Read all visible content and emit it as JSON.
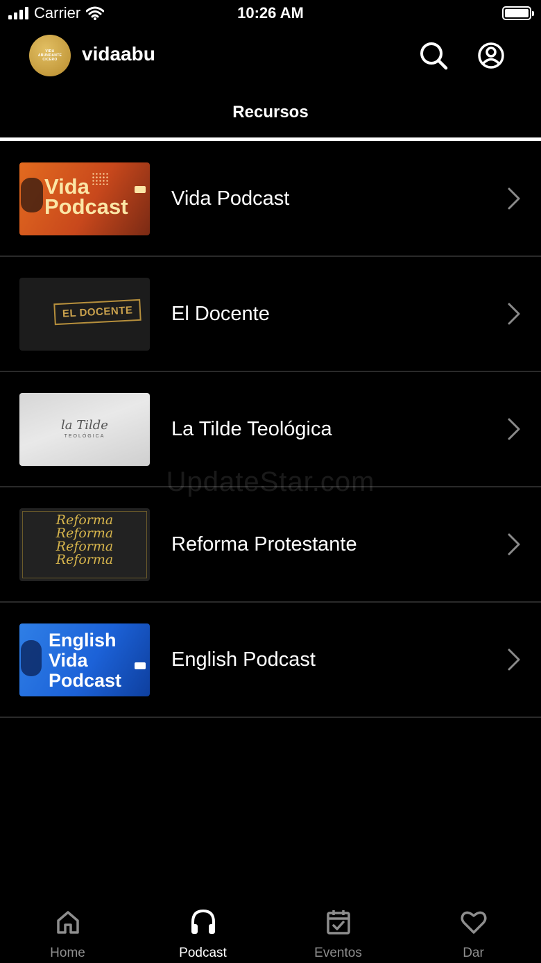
{
  "status_bar": {
    "carrier": "Carrier",
    "time": "10:26 AM"
  },
  "header": {
    "app_name": "vidaabu",
    "logo_lines": [
      "VIDA",
      "ABUNDANTE",
      "CICERO"
    ],
    "search_icon": "search-icon",
    "profile_icon": "user-circle-icon"
  },
  "tab": {
    "label": "Recursos"
  },
  "list": {
    "items": [
      {
        "label": "Vida Podcast",
        "thumb_title_1": "Vida",
        "thumb_title_2": "Podcast"
      },
      {
        "label": "El Docente",
        "thumb_title": "EL DOCENTE"
      },
      {
        "label": "La Tilde Teológica",
        "thumb_title": "la Tilde",
        "thumb_subtitle": "TEOLÓGICA"
      },
      {
        "label": "Reforma Protestante",
        "thumb_words": [
          "Reforma",
          "Reforma",
          "Reforma",
          "Reforma"
        ]
      },
      {
        "label": "English Podcast",
        "thumb_title_1": "English",
        "thumb_title_2": "Vida",
        "thumb_title_3": "Podcast"
      }
    ]
  },
  "watermark": "UpdateStar.com",
  "bottom_nav": {
    "items": [
      {
        "label": "Home",
        "icon": "home-icon",
        "active": false
      },
      {
        "label": "Podcast",
        "icon": "headphones-icon",
        "active": true
      },
      {
        "label": "Eventos",
        "icon": "calendar-check-icon",
        "active": false
      },
      {
        "label": "Dar",
        "icon": "heart-icon",
        "active": false
      }
    ]
  },
  "colors": {
    "background": "#000000",
    "text": "#ffffff",
    "inactive": "#8e8e8e",
    "divider": "#2a2a2a",
    "logo_gold": "#c9a044"
  }
}
